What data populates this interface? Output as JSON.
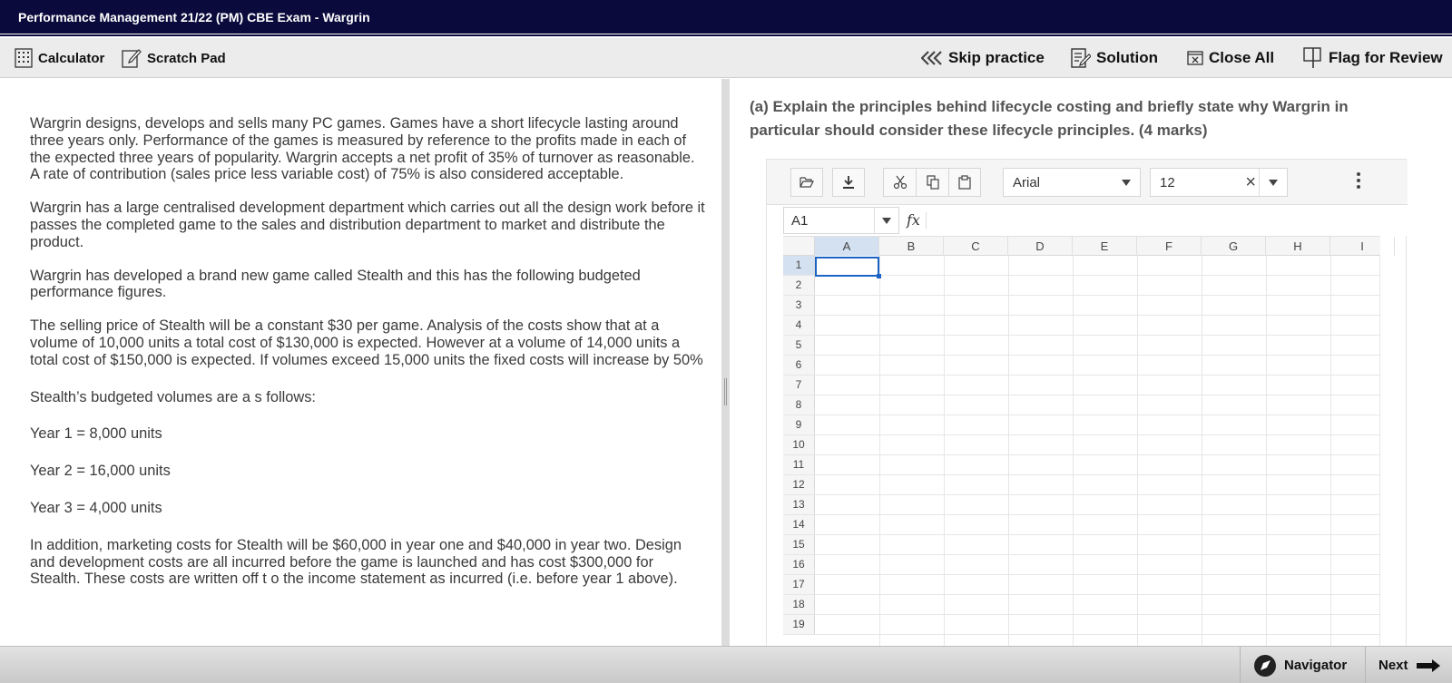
{
  "window": {
    "title": "Performance Management 21/22 (PM) CBE Exam - Wargrin"
  },
  "toolbar": {
    "calculator": "Calculator",
    "scratch_pad": "Scratch Pad",
    "skip_practice": "Skip practice",
    "solution": "Solution",
    "close_all": "Close All",
    "flag_for_review": "Flag for Review"
  },
  "scenario": {
    "paragraphs": [
      "Wargrin designs, develops and sells many PC games. Games have a short lifecycle lasting around three years only. Performance of the games is measured by reference to the profits made in each of the expected three years of popularity. Wargrin accepts a net profit of 35% of turnover as reasonable. A rate of contribution (sales price less variable cost) of 75% is also considered acceptable.",
      "Wargrin has a large centralised development department which carries out all the design work before it passes the completed game to the sales and distribution department to market and distribute the product.",
      "Wargrin has developed a brand new game called Stealth and this has the following budgeted performance figures.",
      "The selling price of Stealth will be a constant $30 per game. Analysis of the costs show that at a volume of 10,000 units a total cost of $130,000 is expected. However at a volume of 14,000 units a total cost of $150,000 is expected. If volumes exceed 15,000 units the fixed costs will increase by 50%",
      "Stealth’s budgeted volumes are a s follows:",
      "Year 1 = 8,000 units",
      "Year 2 = 16,000 units",
      "Year 3 = 4,000 units",
      "In addition, marketing costs for Stealth will be $60,000 in year one and $40,000 in year two. Design and development costs are all incurred before the game is launched and has cost $300,000 for Stealth. These costs are written off t o the income statement as incurred (i.e. before year 1 above)."
    ]
  },
  "question": {
    "text": "(a) Explain the principles behind lifecycle costing and briefly state why Wargrin in particular should consider these lifecycle principles. (4 marks)"
  },
  "spreadsheet": {
    "font": "Arial",
    "font_size": "12",
    "cell_ref": "A1",
    "fx_label": "fx",
    "columns": [
      "A",
      "B",
      "C",
      "D",
      "E",
      "F",
      "G",
      "H",
      "I"
    ],
    "rows": [
      "1",
      "2",
      "3",
      "4",
      "5",
      "6",
      "7",
      "8",
      "9",
      "10",
      "11",
      "12",
      "13",
      "14",
      "15",
      "16",
      "17",
      "18",
      "19"
    ]
  },
  "bottom": {
    "navigator": "Navigator",
    "next": "Next"
  }
}
